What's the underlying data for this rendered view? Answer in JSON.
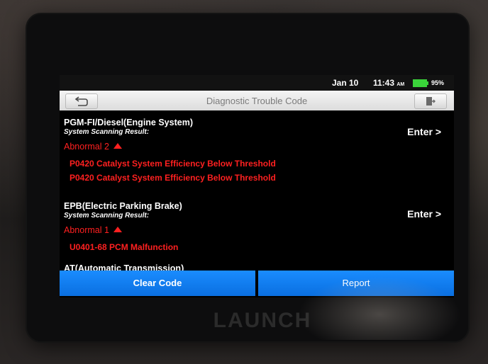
{
  "status_bar": {
    "date": "Jan 10",
    "time": "11:43",
    "ampm": "AM",
    "battery": "95%",
    "battery_color": "#3ad33a"
  },
  "title_bar": {
    "title": "Diagnostic Trouble Code",
    "back_icon": "back-arrow-icon",
    "exit_icon": "exit-icon"
  },
  "systems": [
    {
      "name": "PGM-FI/Diesel(Engine System)",
      "subtitle": "System Scanning Result:",
      "status": "Abnormal 2",
      "enter_label": "Enter >",
      "codes": [
        "P0420 Catalyst System Efficiency Below Threshold",
        "P0420 Catalyst System Efficiency Below Threshold"
      ]
    },
    {
      "name": "EPB(Electric Parking Brake)",
      "subtitle": "System Scanning Result:",
      "status": "Abnormal 1",
      "enter_label": "Enter >",
      "codes": [
        "U0401-68 PCM Malfunction"
      ]
    },
    {
      "name": "AT(Automatic Transmission)"
    }
  ],
  "bottom_bar": {
    "clear_label": "Clear Code",
    "report_label": "Report",
    "accent_color": "#1a8cff"
  },
  "device": {
    "brand": "LAUNCH"
  },
  "colors": {
    "error": "#ff2020",
    "background": "#000000"
  }
}
